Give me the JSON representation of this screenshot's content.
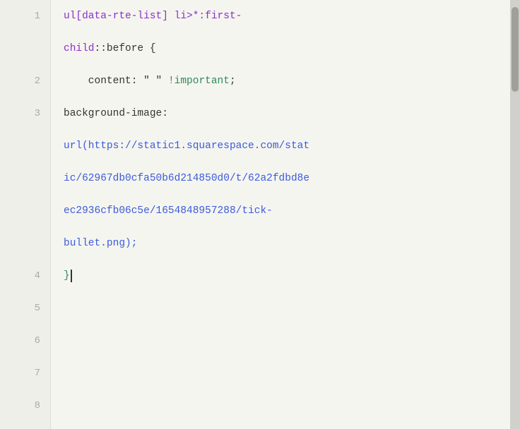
{
  "editor": {
    "background": "#f5f5f0",
    "lines": [
      {
        "number": "1",
        "tokens": [
          {
            "text": "ul[data-rte-list] li>*:first-",
            "color": "purple"
          },
          {
            "text": "",
            "color": "dark"
          }
        ],
        "raw": "ul[data-rte-list] li>*:first-"
      },
      {
        "number": "",
        "tokens": [
          {
            "text": "child",
            "color": "purple"
          },
          {
            "text": "::before {",
            "color": "dark"
          }
        ],
        "raw": "child::before {"
      },
      {
        "number": "2",
        "tokens": [
          {
            "text": "    content: \" \" ",
            "color": "dark"
          },
          {
            "text": "!important",
            "color": "green"
          },
          {
            "text": ";",
            "color": "dark"
          }
        ],
        "raw": "    content: \" \" !important;"
      },
      {
        "number": "3",
        "tokens": [
          {
            "text": "background-image:",
            "color": "dark"
          }
        ],
        "raw": "background-image:"
      },
      {
        "number": "",
        "tokens": [
          {
            "text": "url(https://static1.squarespace.com/stat",
            "color": "blue"
          }
        ],
        "raw": "url(https://static1.squarespace.com/stat"
      },
      {
        "number": "",
        "tokens": [
          {
            "text": "ic/62967db0cfa50b6d214850d0/t/62a2fdbd8e",
            "color": "blue"
          }
        ],
        "raw": "ic/62967db0cfa50b6d214850d0/t/62a2fdbd8e"
      },
      {
        "number": "",
        "tokens": [
          {
            "text": "ec2936cfb06c5e/1654848957288/tick-",
            "color": "blue"
          }
        ],
        "raw": "ec2936cfb06c5e/1654848957288/tick-"
      },
      {
        "number": "",
        "tokens": [
          {
            "text": "bullet.png);",
            "color": "blue"
          }
        ],
        "raw": "bullet.png);"
      },
      {
        "number": "4",
        "tokens": [
          {
            "text": "}",
            "color": "green"
          },
          {
            "text": "|",
            "color": "cursor"
          }
        ],
        "raw": "}"
      },
      {
        "number": "5",
        "tokens": [],
        "raw": ""
      },
      {
        "number": "6",
        "tokens": [],
        "raw": ""
      },
      {
        "number": "7",
        "tokens": [],
        "raw": ""
      },
      {
        "number": "8",
        "tokens": [],
        "raw": ""
      }
    ]
  }
}
